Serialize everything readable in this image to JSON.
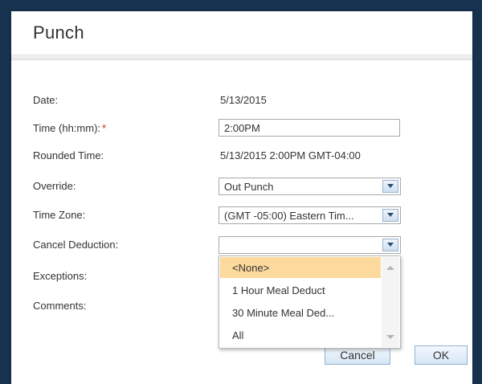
{
  "dialog": {
    "title": "Punch"
  },
  "form": {
    "date": {
      "label": "Date:",
      "value": "5/13/2015"
    },
    "time": {
      "label": "Time (hh:mm):",
      "required_mark": "*",
      "value": "2:00PM"
    },
    "rounded_time": {
      "label": "Rounded Time:",
      "value": "5/13/2015 2:00PM GMT-04:00"
    },
    "override": {
      "label": "Override:",
      "value": "Out Punch"
    },
    "time_zone": {
      "label": "Time Zone:",
      "value": "(GMT -05:00) Eastern Tim..."
    },
    "cancel_deduction": {
      "label": "Cancel Deduction:",
      "value": "",
      "options": [
        "<None>",
        "1 Hour Meal Deduct",
        "30 Minute Meal Ded...",
        "All"
      ],
      "highlighted_index": 0
    },
    "exceptions": {
      "label": "Exceptions:"
    },
    "comments": {
      "label": "Comments:"
    }
  },
  "buttons": {
    "cancel": "Cancel",
    "ok": "OK"
  },
  "colors": {
    "backdrop": "#17324f",
    "required": "#d9232a",
    "highlight": "#fcd99d",
    "button_border": "#8fb2d2"
  },
  "icons": {
    "select_toggle": "chevron-down-icon"
  }
}
